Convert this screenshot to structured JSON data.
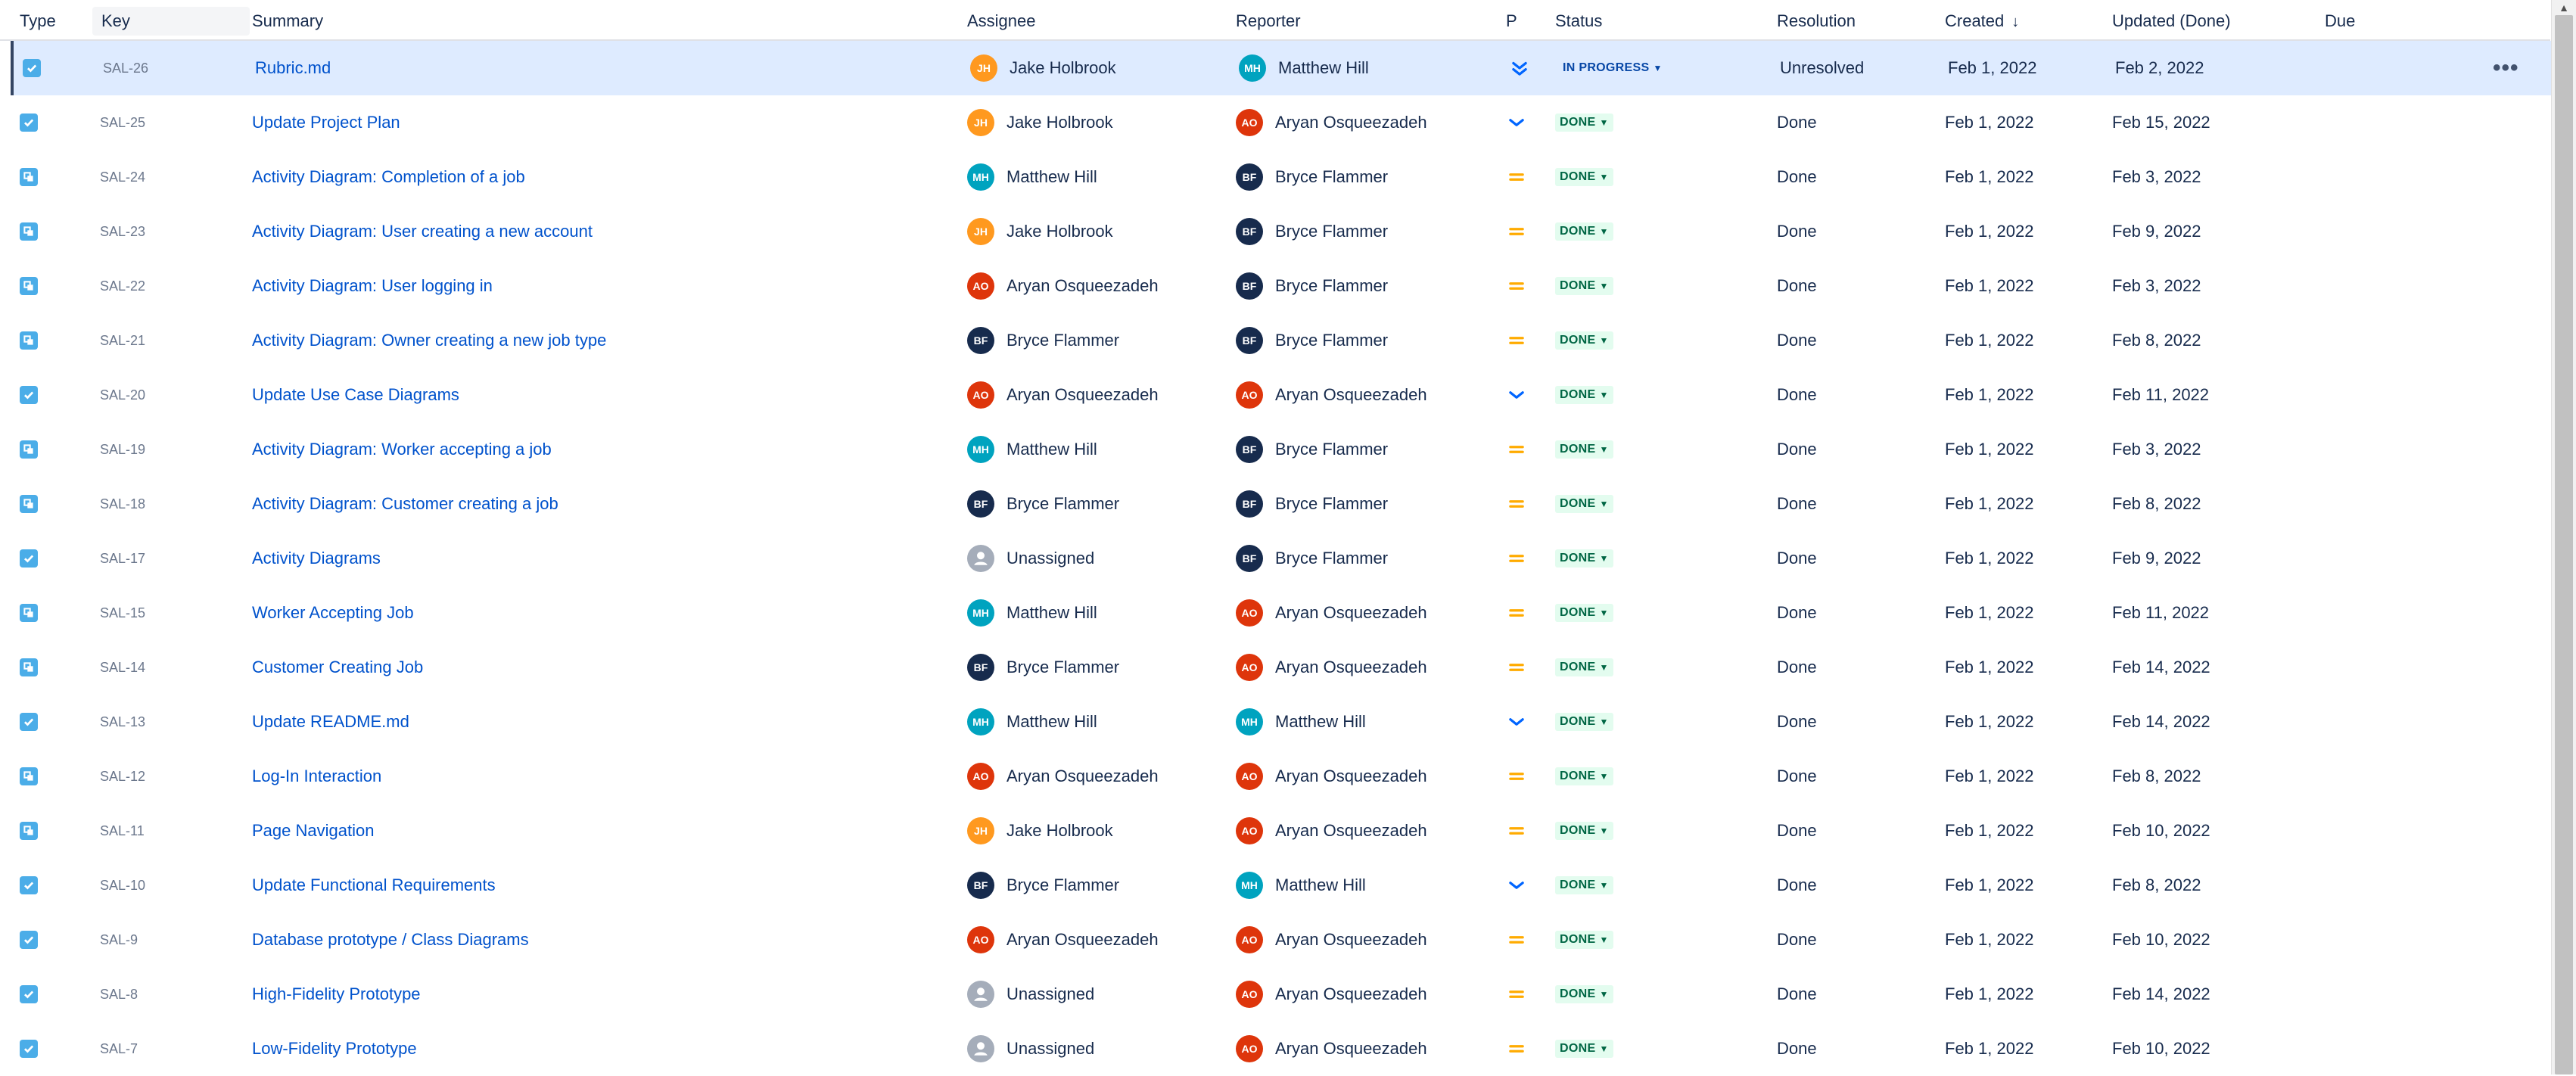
{
  "columns": {
    "type": "Type",
    "key": "Key",
    "summary": "Summary",
    "assignee": "Assignee",
    "reporter": "Reporter",
    "priority": "P",
    "status": "Status",
    "resolution": "Resolution",
    "created": "Created",
    "updated": "Updated (Done)",
    "due": "Due"
  },
  "sort_icon": "arrow-down-icon",
  "colors": {
    "link": "#0052cc",
    "selected_row": "#deebff",
    "task_icon": "#4bade8",
    "priority_medium": "#ffab00",
    "priority_low": "#0065ff",
    "done_bg": "#e3fcef",
    "done_text": "#006644",
    "inprogress_bg": "#deebff",
    "inprogress_text": "#0747a6"
  },
  "people": {
    "JH": {
      "name": "Jake Holbrook",
      "color": "#ff991f"
    },
    "MH": {
      "name": "Matthew Hill",
      "color": "#00a3bf"
    },
    "AO": {
      "name": "Aryan Osqueezadeh",
      "color": "#de350b"
    },
    "BF": {
      "name": "Bryce Flammer",
      "color": "#172b4d"
    }
  },
  "rows": [
    {
      "type": "task",
      "key": "SAL-26",
      "summary": "Rubric.md",
      "assignee_initials": "JH",
      "assignee": "Jake Holbrook",
      "reporter_initials": "MH",
      "reporter": "Matthew Hill",
      "priority": "lowest",
      "status": "IN PROGRESS",
      "resolution": "Unresolved",
      "created": "Feb 1, 2022",
      "updated": "Feb 2, 2022",
      "due": "",
      "selected": true
    },
    {
      "type": "task",
      "key": "SAL-25",
      "summary": "Update Project Plan",
      "assignee_initials": "JH",
      "assignee": "Jake Holbrook",
      "reporter_initials": "AO",
      "reporter": "Aryan Osqueezadeh",
      "priority": "low",
      "status": "DONE",
      "resolution": "Done",
      "created": "Feb 1, 2022",
      "updated": "Feb 15, 2022",
      "due": ""
    },
    {
      "type": "subtask",
      "key": "SAL-24",
      "summary": "Activity Diagram: Completion of a job",
      "assignee_initials": "MH",
      "assignee": "Matthew Hill",
      "reporter_initials": "BF",
      "reporter": "Bryce Flammer",
      "priority": "medium",
      "status": "DONE",
      "resolution": "Done",
      "created": "Feb 1, 2022",
      "updated": "Feb 3, 2022",
      "due": ""
    },
    {
      "type": "subtask",
      "key": "SAL-23",
      "summary": "Activity Diagram: User creating a new account",
      "assignee_initials": "JH",
      "assignee": "Jake Holbrook",
      "reporter_initials": "BF",
      "reporter": "Bryce Flammer",
      "priority": "medium",
      "status": "DONE",
      "resolution": "Done",
      "created": "Feb 1, 2022",
      "updated": "Feb 9, 2022",
      "due": ""
    },
    {
      "type": "subtask",
      "key": "SAL-22",
      "summary": "Activity Diagram: User logging in",
      "assignee_initials": "AO",
      "assignee": "Aryan Osqueezadeh",
      "reporter_initials": "BF",
      "reporter": "Bryce Flammer",
      "priority": "medium",
      "status": "DONE",
      "resolution": "Done",
      "created": "Feb 1, 2022",
      "updated": "Feb 3, 2022",
      "due": ""
    },
    {
      "type": "subtask",
      "key": "SAL-21",
      "summary": "Activity Diagram: Owner creating a new job type",
      "assignee_initials": "BF",
      "assignee": "Bryce Flammer",
      "reporter_initials": "BF",
      "reporter": "Bryce Flammer",
      "priority": "medium",
      "status": "DONE",
      "resolution": "Done",
      "created": "Feb 1, 2022",
      "updated": "Feb 8, 2022",
      "due": ""
    },
    {
      "type": "task",
      "key": "SAL-20",
      "summary": "Update Use Case Diagrams",
      "assignee_initials": "AO",
      "assignee": "Aryan Osqueezadeh",
      "reporter_initials": "AO",
      "reporter": "Aryan Osqueezadeh",
      "priority": "low",
      "status": "DONE",
      "resolution": "Done",
      "created": "Feb 1, 2022",
      "updated": "Feb 11, 2022",
      "due": ""
    },
    {
      "type": "subtask",
      "key": "SAL-19",
      "summary": "Activity Diagram: Worker accepting a job",
      "assignee_initials": "MH",
      "assignee": "Matthew Hill",
      "reporter_initials": "BF",
      "reporter": "Bryce Flammer",
      "priority": "medium",
      "status": "DONE",
      "resolution": "Done",
      "created": "Feb 1, 2022",
      "updated": "Feb 3, 2022",
      "due": ""
    },
    {
      "type": "subtask",
      "key": "SAL-18",
      "summary": "Activity Diagram: Customer creating a job",
      "assignee_initials": "BF",
      "assignee": "Bryce Flammer",
      "reporter_initials": "BF",
      "reporter": "Bryce Flammer",
      "priority": "medium",
      "status": "DONE",
      "resolution": "Done",
      "created": "Feb 1, 2022",
      "updated": "Feb 8, 2022",
      "due": ""
    },
    {
      "type": "task",
      "key": "SAL-17",
      "summary": "Activity Diagrams",
      "assignee_initials": "",
      "assignee": "Unassigned",
      "reporter_initials": "BF",
      "reporter": "Bryce Flammer",
      "priority": "medium",
      "status": "DONE",
      "resolution": "Done",
      "created": "Feb 1, 2022",
      "updated": "Feb 9, 2022",
      "due": ""
    },
    {
      "type": "subtask",
      "key": "SAL-15",
      "summary": "Worker Accepting Job",
      "assignee_initials": "MH",
      "assignee": "Matthew Hill",
      "reporter_initials": "AO",
      "reporter": "Aryan Osqueezadeh",
      "priority": "medium",
      "status": "DONE",
      "resolution": "Done",
      "created": "Feb 1, 2022",
      "updated": "Feb 11, 2022",
      "due": ""
    },
    {
      "type": "subtask",
      "key": "SAL-14",
      "summary": "Customer Creating Job",
      "assignee_initials": "BF",
      "assignee": "Bryce Flammer",
      "reporter_initials": "AO",
      "reporter": "Aryan Osqueezadeh",
      "priority": "medium",
      "status": "DONE",
      "resolution": "Done",
      "created": "Feb 1, 2022",
      "updated": "Feb 14, 2022",
      "due": ""
    },
    {
      "type": "task",
      "key": "SAL-13",
      "summary": "Update README.md",
      "assignee_initials": "MH",
      "assignee": "Matthew Hill",
      "reporter_initials": "MH",
      "reporter": "Matthew Hill",
      "priority": "low",
      "status": "DONE",
      "resolution": "Done",
      "created": "Feb 1, 2022",
      "updated": "Feb 14, 2022",
      "due": ""
    },
    {
      "type": "subtask",
      "key": "SAL-12",
      "summary": "Log-In Interaction",
      "assignee_initials": "AO",
      "assignee": "Aryan Osqueezadeh",
      "reporter_initials": "AO",
      "reporter": "Aryan Osqueezadeh",
      "priority": "medium",
      "status": "DONE",
      "resolution": "Done",
      "created": "Feb 1, 2022",
      "updated": "Feb 8, 2022",
      "due": ""
    },
    {
      "type": "subtask",
      "key": "SAL-11",
      "summary": "Page Navigation",
      "assignee_initials": "JH",
      "assignee": "Jake Holbrook",
      "reporter_initials": "AO",
      "reporter": "Aryan Osqueezadeh",
      "priority": "medium",
      "status": "DONE",
      "resolution": "Done",
      "created": "Feb 1, 2022",
      "updated": "Feb 10, 2022",
      "due": ""
    },
    {
      "type": "task",
      "key": "SAL-10",
      "summary": "Update Functional Requirements",
      "assignee_initials": "BF",
      "assignee": "Bryce Flammer",
      "reporter_initials": "MH",
      "reporter": "Matthew Hill",
      "priority": "low",
      "status": "DONE",
      "resolution": "Done",
      "created": "Feb 1, 2022",
      "updated": "Feb 8, 2022",
      "due": ""
    },
    {
      "type": "task",
      "key": "SAL-9",
      "summary": "Database prototype / Class Diagrams",
      "assignee_initials": "AO",
      "assignee": "Aryan Osqueezadeh",
      "reporter_initials": "AO",
      "reporter": "Aryan Osqueezadeh",
      "priority": "medium",
      "status": "DONE",
      "resolution": "Done",
      "created": "Feb 1, 2022",
      "updated": "Feb 10, 2022",
      "due": ""
    },
    {
      "type": "task",
      "key": "SAL-8",
      "summary": "High-Fidelity Prototype",
      "assignee_initials": "",
      "assignee": "Unassigned",
      "reporter_initials": "AO",
      "reporter": "Aryan Osqueezadeh",
      "priority": "medium",
      "status": "DONE",
      "resolution": "Done",
      "created": "Feb 1, 2022",
      "updated": "Feb 14, 2022",
      "due": ""
    },
    {
      "type": "task",
      "key": "SAL-7",
      "summary": "Low-Fidelity Prototype",
      "assignee_initials": "",
      "assignee": "Unassigned",
      "reporter_initials": "AO",
      "reporter": "Aryan Osqueezadeh",
      "priority": "medium",
      "status": "DONE",
      "resolution": "Done",
      "created": "Feb 1, 2022",
      "updated": "Feb 10, 2022",
      "due": ""
    }
  ]
}
